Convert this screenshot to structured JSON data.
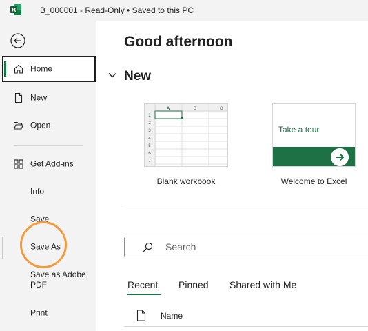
{
  "titlebar": {
    "title": "B_000001  -  Read-Only  •  Saved to this PC",
    "app_icon": "excel-logo",
    "brand_color": "#107c41"
  },
  "sidebar": {
    "back_icon": "back-arrow-icon",
    "items": [
      {
        "label": "Home",
        "icon": "home-icon",
        "selected": true
      },
      {
        "label": "New",
        "icon": "new-document-icon"
      },
      {
        "label": "Open",
        "icon": "folder-open-icon"
      },
      {
        "label": "Get Add-ins",
        "icon": "add-ins-grid-icon"
      },
      {
        "label": "Info"
      },
      {
        "label": "Save"
      },
      {
        "label": "Save As",
        "highlighted": true
      },
      {
        "label": "Save as Adobe PDF"
      },
      {
        "label": "Print"
      }
    ]
  },
  "main": {
    "greeting": "Good afternoon",
    "new_section": {
      "title": "New",
      "chevron_icon": "chevron-down-icon"
    },
    "templates": [
      {
        "label": "Blank workbook",
        "columns": [
          "A",
          "B",
          "C"
        ],
        "rows": [
          "1",
          "2",
          "3",
          "4",
          "5",
          "6",
          "7"
        ]
      },
      {
        "label": "Welcome to Excel",
        "card_text": "Take a tour",
        "arrow_icon": "arrow-right-icon"
      }
    ],
    "search": {
      "placeholder": "Search",
      "value": "",
      "icon": "search-icon"
    },
    "tabs": [
      {
        "label": "Recent",
        "active": true
      },
      {
        "label": "Pinned"
      },
      {
        "label": "Shared with Me"
      }
    ],
    "file_list": {
      "name_column": "Name",
      "icon": "file-icon"
    }
  },
  "colors": {
    "accent": "#1e7145",
    "highlight_ring": "#f39a3c",
    "selected_border": "#1f1f1f"
  }
}
